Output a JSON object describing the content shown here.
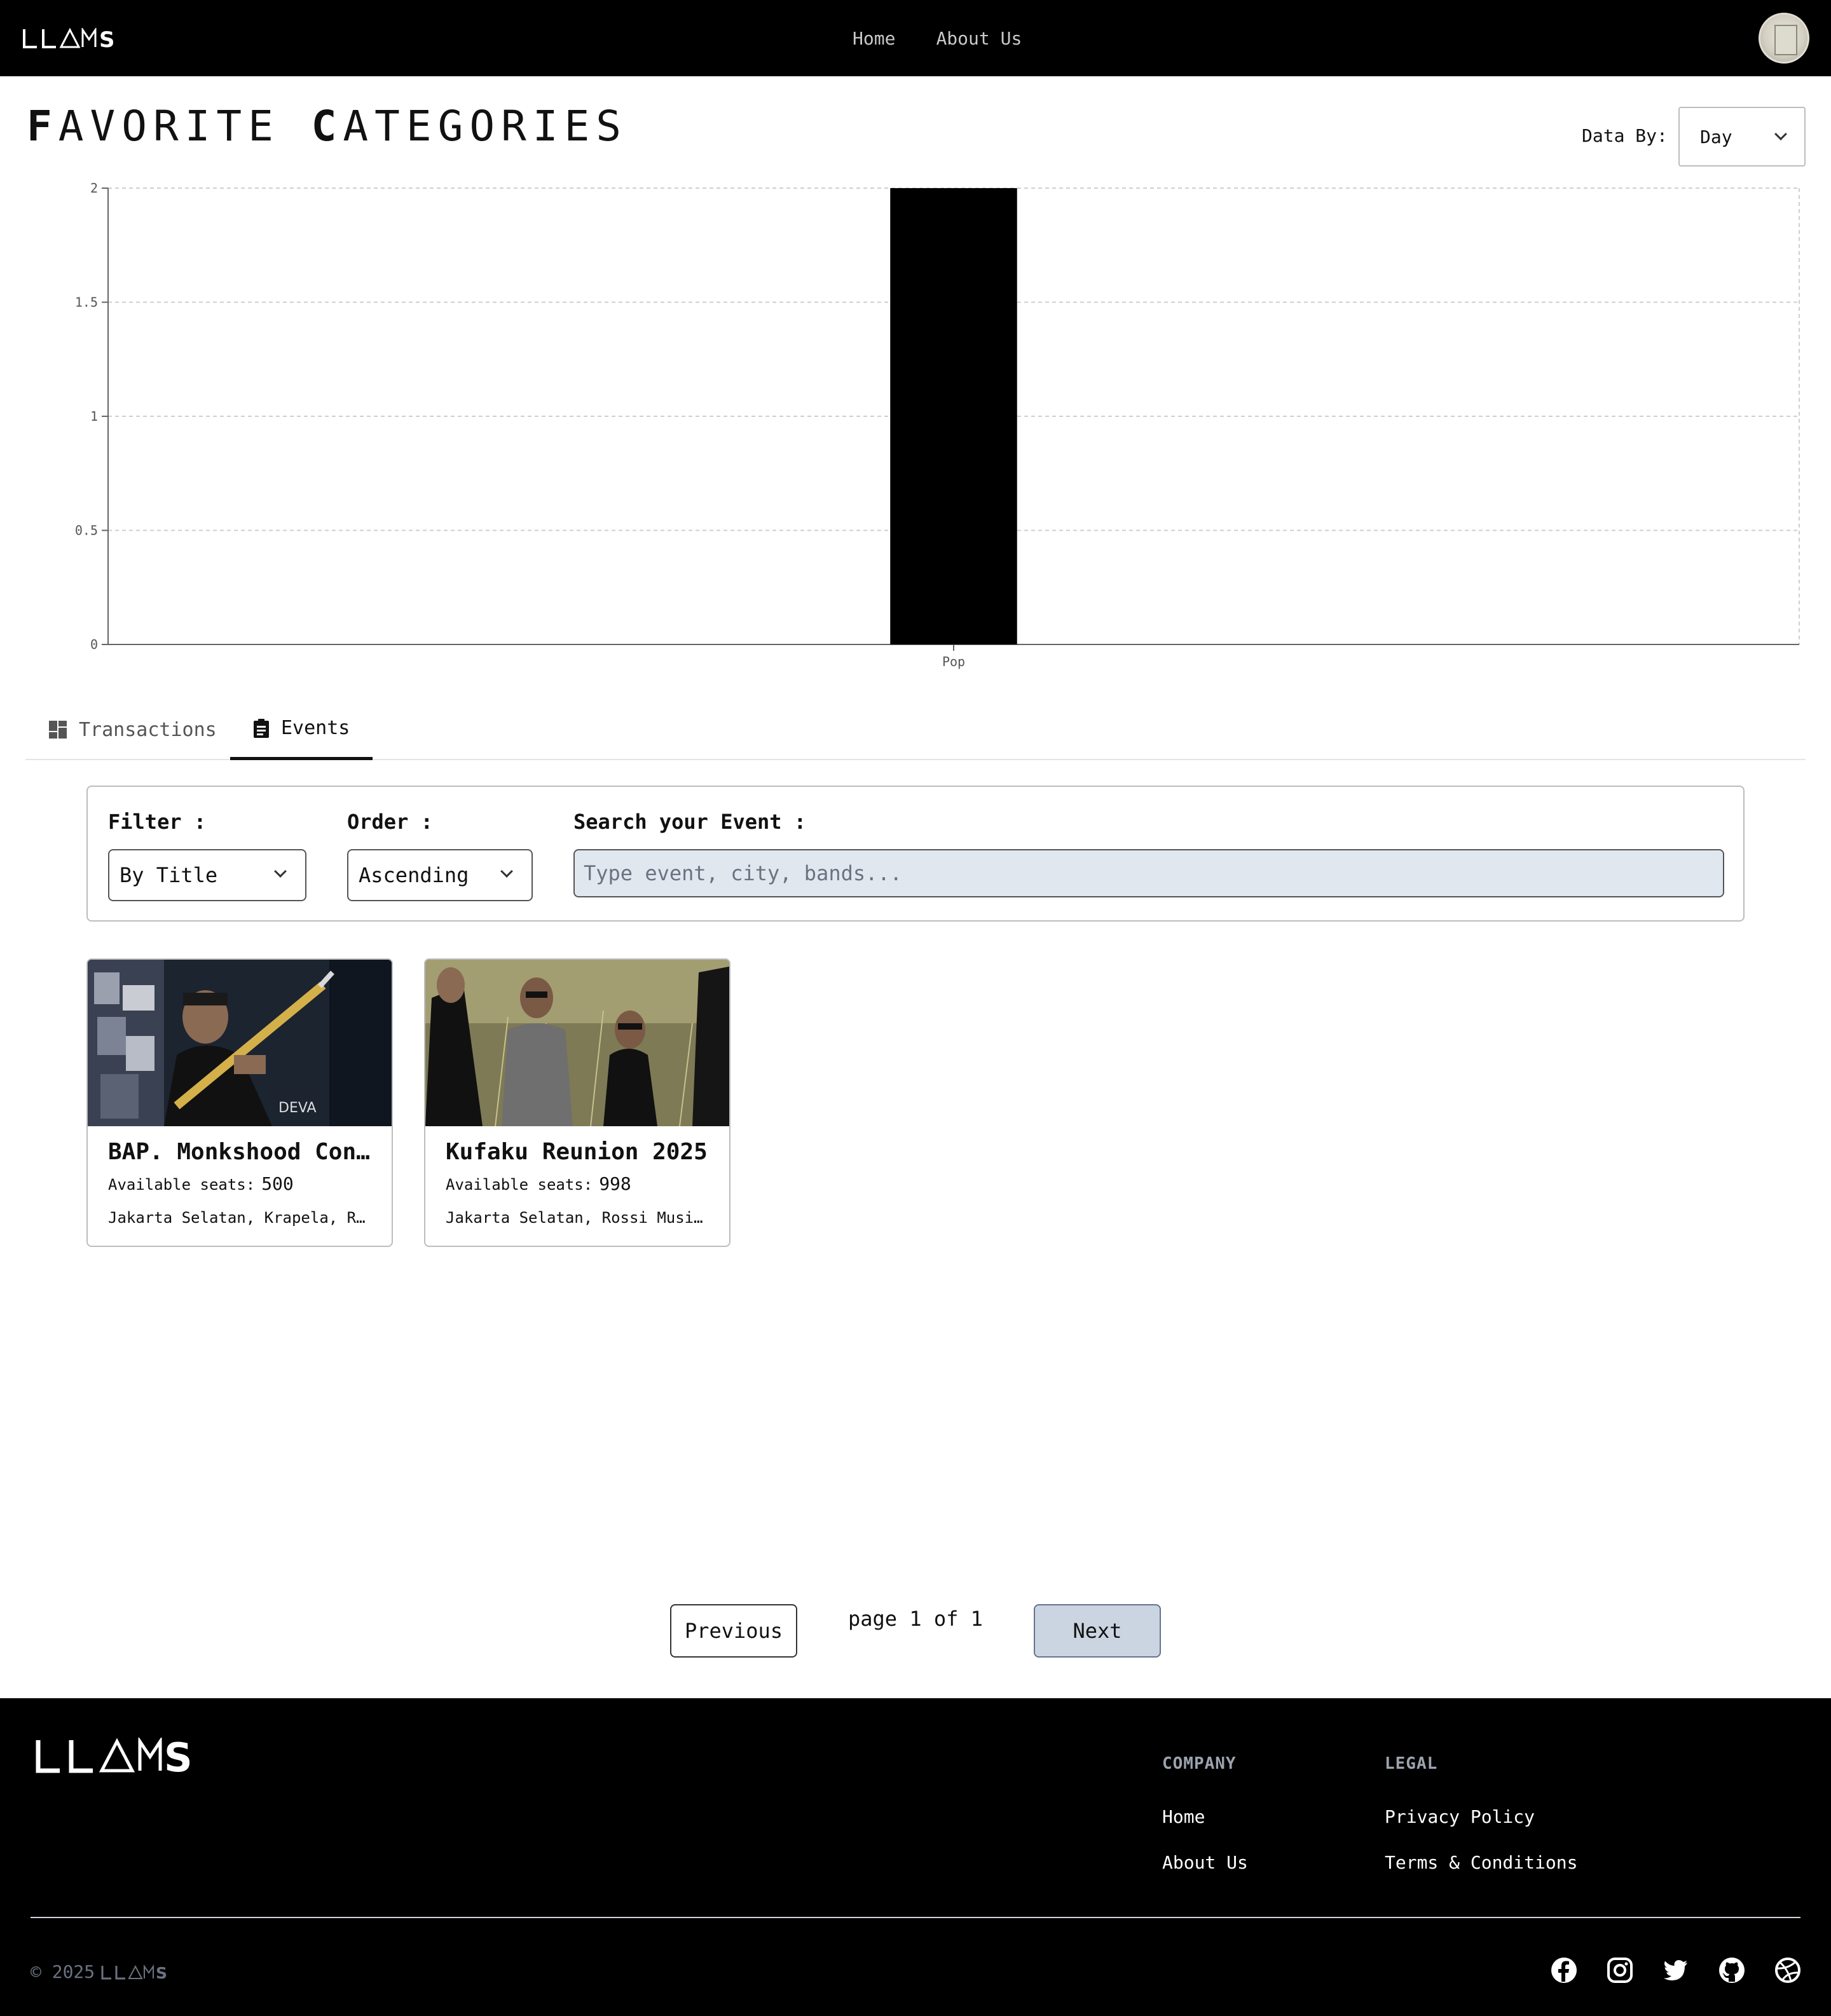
{
  "brand": {
    "logo_text": "LLAMS"
  },
  "topnav": {
    "home": "Home",
    "about": "About Us"
  },
  "page": {
    "title_first_cap": "F",
    "title_first_rest": "AVORITE",
    "title_second_cap": "C",
    "title_second_rest": "ATEGORIES"
  },
  "data_by": {
    "label": "Data By:",
    "value": "Day"
  },
  "chart_data": {
    "type": "bar",
    "categories": [
      "Pop"
    ],
    "values": [
      2
    ],
    "ylim": [
      0,
      2
    ],
    "yticks": [
      "0",
      "0.5",
      "1",
      "1.5",
      "2"
    ],
    "grid": true,
    "bar_color": "#000000"
  },
  "tabs": {
    "transactions": "Transactions",
    "events": "Events"
  },
  "filters": {
    "filter_label": "Filter :",
    "filter_value": "By Title",
    "order_label": "Order :",
    "order_value": "Ascending",
    "search_label": "Search your Event :",
    "search_placeholder": "Type event, city, bands..."
  },
  "events": [
    {
      "title": "BAP. Monkshood Con…",
      "seats_label": "Available seats:",
      "seats": "500",
      "location": "Jakarta Selatan, Krapela, R…"
    },
    {
      "title": "Kufaku Reunion 2025",
      "seats_label": "Available seats:",
      "seats": "998",
      "location": "Jakarta Selatan, Rossi Musi…"
    }
  ],
  "pagination": {
    "previous": "Previous",
    "info": "page 1 of 1",
    "next": "Next"
  },
  "footer": {
    "company_head": "COMPANY",
    "company_home": "Home",
    "company_about": "About Us",
    "legal_head": "LEGAL",
    "legal_privacy": "Privacy Policy",
    "legal_terms": "Terms & Conditions",
    "copyright": "© 2025",
    "social": [
      "facebook-icon",
      "instagram-icon",
      "twitter-icon",
      "github-icon",
      "dribbble-icon"
    ]
  },
  "colors": {
    "accent": "#000000",
    "next_button": "#cbd5e1",
    "search_bg": "#e1e7ef"
  }
}
